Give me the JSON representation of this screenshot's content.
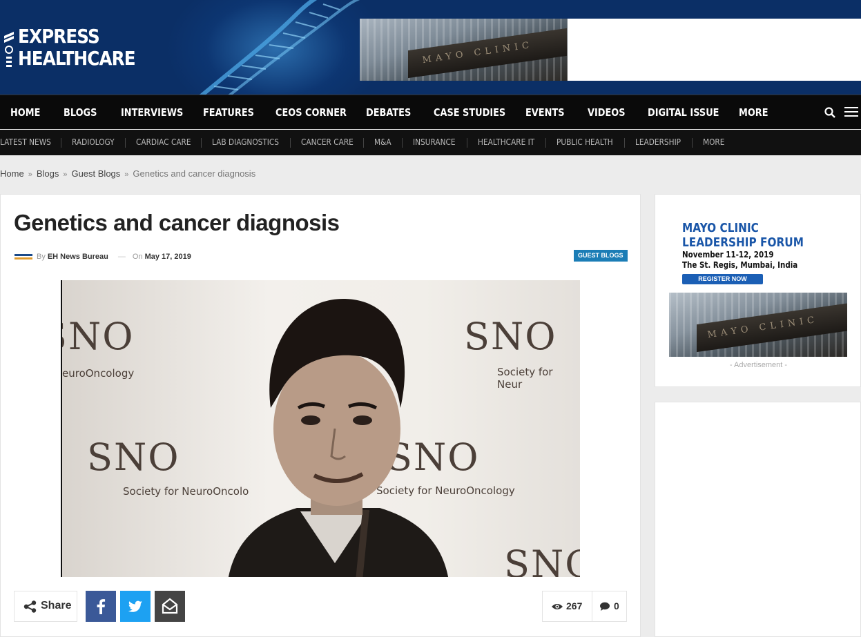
{
  "header": {
    "logo_line1": "EXPRESS",
    "logo_line2": "HEALTHCARE",
    "banner_sign": "MAYO CLINIC"
  },
  "nav": {
    "items": [
      "HOME",
      "BLOGS",
      "INTERVIEWS",
      "FEATURES",
      "CEOS CORNER",
      "DEBATES",
      "CASE STUDIES",
      "EVENTS",
      "VIDEOS",
      "DIGITAL ISSUE",
      "MORE"
    ]
  },
  "subnav": {
    "items": [
      "LATEST NEWS",
      "RADIOLOGY",
      "CARDIAC CARE",
      "LAB DIAGNOSTICS",
      "CANCER CARE",
      "M&A",
      "INSURANCE",
      "HEALTHCARE IT",
      "PUBLIC HEALTH",
      "LEADERSHIP",
      "MORE"
    ]
  },
  "breadcrumb": {
    "home": "Home",
    "blogs": "Blogs",
    "guest": "Guest Blogs",
    "current": "Genetics and cancer diagnosis",
    "sep": "»"
  },
  "article": {
    "title": "Genetics and cancer diagnosis",
    "by": "By",
    "author": "EH News Bureau",
    "dash": "—",
    "on": "On",
    "date": "May 17, 2019",
    "tag": "GUEST BLOGS",
    "photo_text": {
      "sno": "SNO",
      "society": "Society for NeuroOncology",
      "society_partial_right": "Society for Neur",
      "society_partial_left": "euroOncology",
      "society_partial_mid": "Society for NeuroOncolo"
    }
  },
  "share": {
    "label": "Share",
    "views": "267",
    "comments": "0"
  },
  "sidebar": {
    "ad_title_line1": "MAYO CLINIC",
    "ad_title_line2": "LEADERSHIP FORUM",
    "ad_date": "November 11-12, 2019",
    "ad_venue": "The St. Regis, Mumbai, India",
    "ad_button": "REGISTER NOW",
    "ad_sign": "MAYO CLINIC",
    "ad_caption": "- Advertisement -"
  },
  "colors": {
    "header_bg": "#0b2f66",
    "nav_bg": "#0a0a0a",
    "tag_bg": "#1b7db6",
    "facebook": "#3b5998",
    "twitter": "#1da1f2",
    "email": "#444444",
    "ad_blue": "#1a56a8"
  }
}
